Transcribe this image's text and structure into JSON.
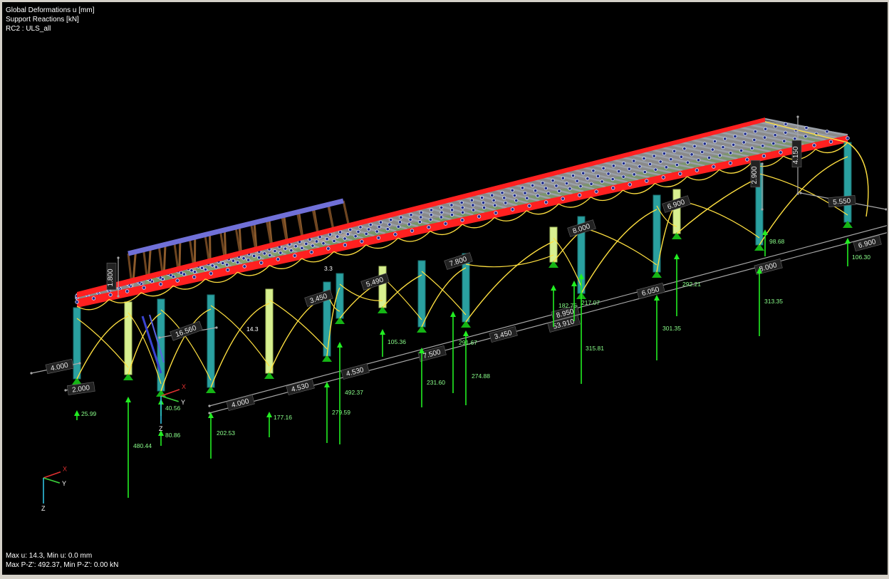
{
  "viewport": {
    "info_lines": [
      "Global Deformations u [mm]",
      "Support Reactions [kN]",
      "RC2 : ULS_all"
    ],
    "summary_lines": [
      "Max u: 14.3, Min u: 0.0 mm",
      "Max P-Z': 492.37, Min P-Z': 0.00 kN"
    ]
  },
  "colors": {
    "background": "#000000",
    "deck_edge": "#ff2020",
    "deck_top": "#b8b8b8",
    "deformed_shape": "#ffe040",
    "column": "#2aa0a0",
    "reaction_arrow": "#22ee22",
    "support": "#15b515",
    "truss": "#8b5a2b",
    "truss_top_chord": "#7070d8"
  },
  "dimensions": {
    "along_x": [
      "4.000",
      "4.530",
      "4.530",
      "7.500",
      "3.450",
      "8.950",
      "6.050",
      "8.000",
      "6.900",
      "53.910"
    ],
    "left_end": [
      "4.000",
      "2.000"
    ],
    "on_structure": [
      "16.560",
      "3.450",
      "5.490",
      "7.800",
      "8.000",
      "6.900",
      "5.550"
    ],
    "heights": [
      "1.800",
      "2.900",
      "4.150"
    ]
  },
  "deformation_labels": [
    "14.3",
    "3.3"
  ],
  "reactions": [
    "25.99",
    "480.44",
    "40.56",
    "80.86",
    "202.53",
    "177.16",
    "279.59",
    "492.37",
    "105.36",
    "231.60",
    "291.67",
    "274.88",
    "182.75",
    "217.07",
    "315.81",
    "301.35",
    "292.21",
    "313.35",
    "98.68",
    "106.30"
  ],
  "axes": {
    "x": "X",
    "y": "Y",
    "z": "Z"
  }
}
